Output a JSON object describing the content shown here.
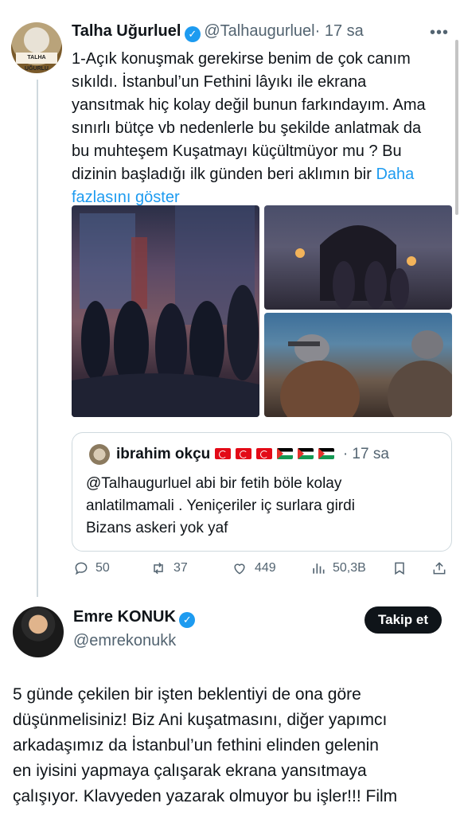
{
  "tweet": {
    "avatar_text": "TALHA UĞURLU",
    "name": "Talha Uğurluel",
    "handle": "@Talhaugurluel",
    "time": "· 17 sa",
    "more": "•••",
    "text_lines": [
      "1-Açık konuşmak gerekirse benim de çok canım",
      "sıkıldı. İstanbul’un Fethini lâyıkı ile ekrana",
      "yansıtmak hiç kolay değil bunun farkındayım. Ama",
      "sınırlı bütçe vb nedenlerle bu şekilde anlatmak da",
      "bu muhteşem Kuşatmayı küçültmüyor mu ? Bu",
      "dizinin başladığı ilk günden beri aklımın bir"
    ],
    "show_more": "Daha",
    "show_more_2": "fazlasını göster"
  },
  "quote": {
    "name": "ibrahim okçu",
    "time": "· 17 sa",
    "text_lines": [
      "@Talhaugurluel abi bir fetih böle kolay",
      "anlatilmamali . Yeniçeriler iç surlara girdi",
      "Bizans askeri yok yaf"
    ]
  },
  "actions": {
    "replies": "50",
    "retweets": "37",
    "likes": "449",
    "views": "50,3B"
  },
  "reply": {
    "name": "Emre KONUK",
    "handle": "@emrekonukk",
    "follow_label": "Takip et",
    "text_lines": [
      "5 günde çekilen bir işten beklentiyi de ona göre",
      "düşünmelisiniz! Biz Ani kuşatmasını, diğer yapımcı",
      "arkadaşımız da İstanbul’un fethini elinden gelenin",
      "en iyisini yapmaya çalışarak ekrana yansıtmaya",
      "çalışıyor. Klavyeden yazarak olmuyor bu işler!!! Film"
    ]
  },
  "colors": {
    "link": "#1d9bf0",
    "muted": "#536471",
    "verified": "#1d9bf0"
  }
}
